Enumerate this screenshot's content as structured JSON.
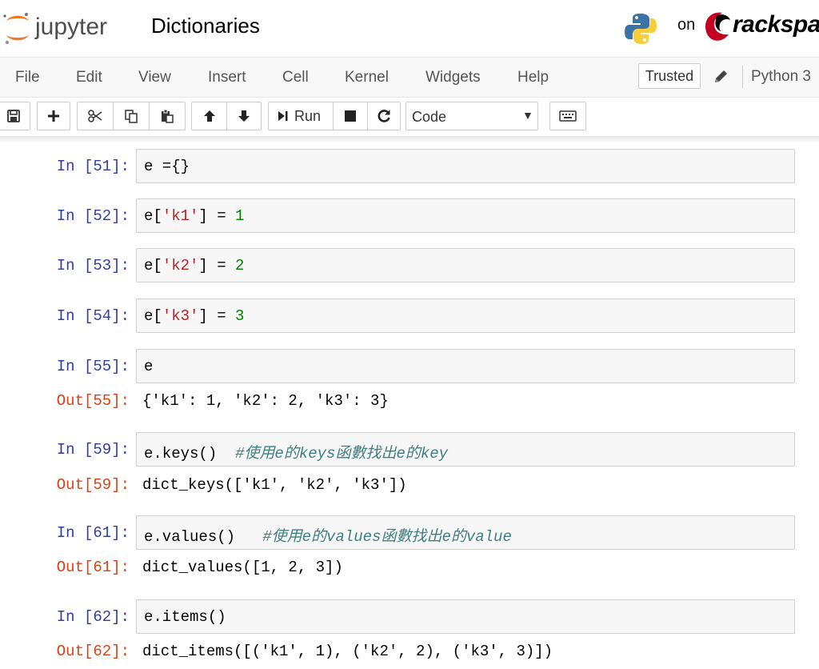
{
  "header": {
    "app_name": "jupyter",
    "notebook_title": "Dictionaries",
    "on_label": "on",
    "host_brand": "rackspace"
  },
  "menubar": {
    "items": [
      "File",
      "Edit",
      "View",
      "Insert",
      "Cell",
      "Kernel",
      "Widgets",
      "Help"
    ],
    "trusted_label": "Trusted",
    "kernel_name": "Python 3"
  },
  "toolbar": {
    "run_label": "Run",
    "cell_type": "Code",
    "buttons": [
      "save-icon",
      "plus-icon",
      "scissors-icon",
      "copy-icon",
      "paste-icon",
      "arrow-up-icon",
      "arrow-down-icon",
      "run-icon",
      "stop-icon",
      "restart-icon",
      "keyboard-icon"
    ]
  },
  "cells": [
    {
      "in_prompt": "In [51]:",
      "code": [
        "e ={}"
      ]
    },
    {
      "in_prompt": "In [52]:",
      "code": [
        "e[",
        "'k1'",
        "] = ",
        "1"
      ]
    },
    {
      "in_prompt": "In [53]:",
      "code": [
        "e[",
        "'k2'",
        "] = ",
        "2"
      ]
    },
    {
      "in_prompt": "In [54]:",
      "code": [
        "e[",
        "'k3'",
        "] = ",
        "3"
      ]
    },
    {
      "in_prompt": "In [55]:",
      "code": [
        "e"
      ],
      "out_prompt": "Out[55]:",
      "output": "{'k1': 1, 'k2': 2, 'k3': 3}"
    },
    {
      "in_prompt": "In [59]:",
      "code": [
        "e.keys()  ",
        "#使用e的keys函數找出e的key"
      ],
      "out_prompt": "Out[59]:",
      "output": "dict_keys(['k1', 'k2', 'k3'])"
    },
    {
      "in_prompt": "In [61]:",
      "code": [
        "e.values()   ",
        "#使用e的values函數找出e的value"
      ],
      "out_prompt": "Out[61]:",
      "output": "dict_values([1, 2, 3])"
    },
    {
      "in_prompt": "In [62]:",
      "code": [
        "e.items()"
      ],
      "out_prompt": "Out[62]:",
      "output": "dict_items([('k1', 1), ('k2', 2), ('k3', 3)])"
    }
  ],
  "colors": {
    "in_prompt": "#303f9f",
    "out_prompt": "#d84315",
    "string": "#ba2121",
    "number": "#008000",
    "comment": "#408080",
    "jupyter_orange": "#f37726"
  }
}
